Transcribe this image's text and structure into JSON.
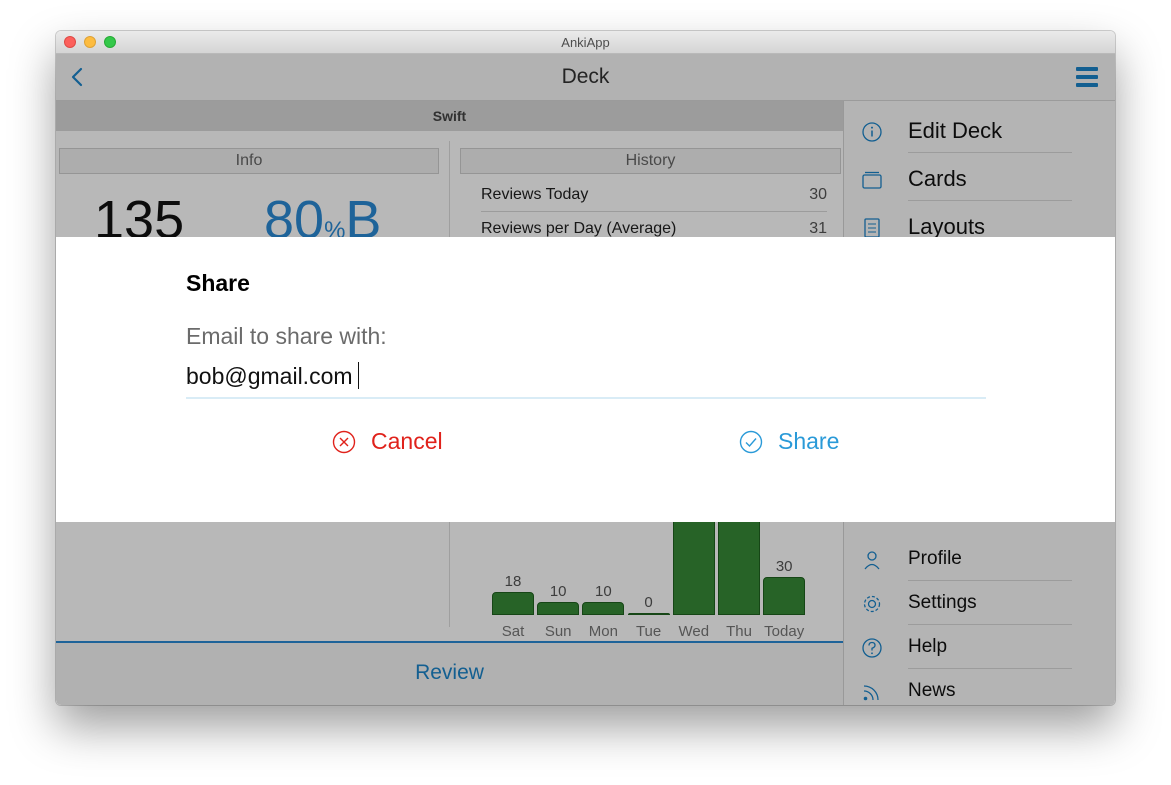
{
  "window": {
    "title": "AnkiApp"
  },
  "navbar": {
    "title": "Deck"
  },
  "deck": {
    "name": "Swift"
  },
  "info": {
    "header": "Info",
    "card_count": "135",
    "percent": "80",
    "percent_sign": "%",
    "grade": "B"
  },
  "history": {
    "header": "History",
    "rows": [
      {
        "label": "Reviews Today",
        "value": "30"
      },
      {
        "label": "Reviews per Day (Average)",
        "value": "31"
      }
    ]
  },
  "chart_data": {
    "type": "bar",
    "categories": [
      "Sat",
      "Sun",
      "Mon",
      "Tue",
      "Wed",
      "Thu",
      "Today"
    ],
    "values": [
      18,
      10,
      10,
      0,
      null,
      null,
      30
    ],
    "value_labels": [
      "18",
      "10",
      "10",
      "0",
      "",
      "",
      "30"
    ],
    "color": "#378a37"
  },
  "review": {
    "label": "Review"
  },
  "sidebar": {
    "items": [
      {
        "label": "Edit Deck",
        "icon": "info-icon"
      },
      {
        "label": "Cards",
        "icon": "cards-icon"
      },
      {
        "label": "Layouts",
        "icon": "layouts-icon"
      },
      {
        "label": "Profile",
        "icon": "profile-icon"
      },
      {
        "label": "Settings",
        "icon": "gear-icon"
      },
      {
        "label": "Help",
        "icon": "help-icon"
      },
      {
        "label": "News",
        "icon": "rss-icon"
      }
    ]
  },
  "dialog": {
    "title": "Share",
    "label": "Email to share with:",
    "email_value": "bob@gmail.com",
    "cancel_label": "Cancel",
    "share_label": "Share"
  },
  "colors": {
    "accent": "#1b84c9",
    "cancel": "#e0221b",
    "share": "#2a9ad8",
    "bar": "#378a37"
  }
}
